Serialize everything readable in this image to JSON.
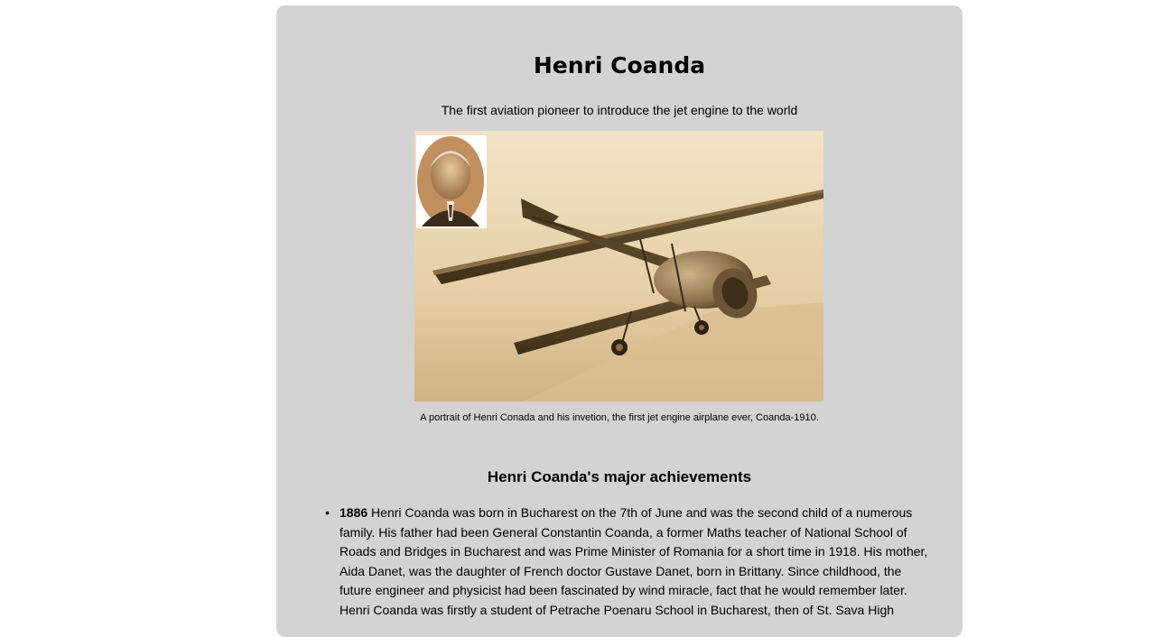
{
  "page": {
    "title": "Henri Coanda",
    "subtitle": "The first aviation pioneer to introduce the jet engine to the world",
    "figure": {
      "portrait_icon": "portrait-photo",
      "airplane_icon": "airplane-photo",
      "caption": "A portrait of Henri Conada and his invetion, the first jet engine airplane ever, Coanda-1910."
    },
    "achievements": {
      "heading": "Henri Coanda's major achievements",
      "items": [
        {
          "year": "1886",
          "text": " Henri Coanda was born in Bucharest on the 7th of June and was the second child of a numerous family. His father had been General Constantin Coanda, a former Maths teacher of National School of Roads and Bridges in Bucharest and was Prime Minister of Romania for a short time in 1918. His mother, Aida Danet, was the daughter of French doctor Gustave Danet, born in Brittany. Since childhood, the future engineer and physicist had been fascinated by wind miracle, fact that he would remember later. Henri Coanda was firstly a student of Petrache Poenaru School in Bucharest, then of St. Sava High"
        }
      ]
    }
  },
  "colors": {
    "card_background": "#d3d3d3",
    "page_background": "#ffffff",
    "photo_sepia": "#d8bd8e"
  }
}
